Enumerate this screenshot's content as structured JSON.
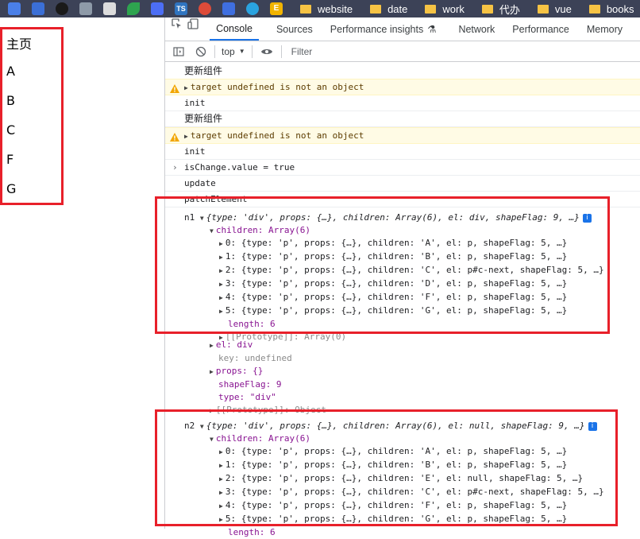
{
  "bookmarks": {
    "folders": [
      "website",
      "date",
      "work",
      "代办",
      "vue",
      "books"
    ],
    "icons": [
      {
        "name": "translate-icon",
        "color": "#4a7fe8",
        "label": ""
      },
      {
        "name": "shield-icon",
        "color": "#3b6fd6",
        "label": ""
      },
      {
        "name": "github-icon",
        "color": "#1a1a1a",
        "label": ""
      },
      {
        "name": "doc-icon",
        "color": "#8e9aa8",
        "label": ""
      },
      {
        "name": "page-icon",
        "color": "#dcdcdc",
        "label": ""
      },
      {
        "name": "leaf-icon",
        "color": "#2ea44f",
        "label": ""
      },
      {
        "name": "box-icon",
        "color": "#4c6ef5",
        "label": ""
      },
      {
        "name": "ts-icon",
        "color": "#2f74c0",
        "label": "TS"
      },
      {
        "name": "chrome-icon",
        "color": "#dd4b39",
        "label": ""
      },
      {
        "name": "check-icon",
        "color": "#3f6fe0",
        "label": ""
      },
      {
        "name": "telegram-icon",
        "color": "#2aa3e0",
        "label": ""
      },
      {
        "name": "e-icon",
        "color": "#f2b400",
        "label": "E"
      }
    ]
  },
  "page": {
    "items": [
      "主页",
      "A",
      "B",
      "C",
      "F",
      "G"
    ]
  },
  "devtools": {
    "tabs": [
      "Console",
      "Sources",
      "Performance insights",
      "Network",
      "Performance",
      "Memory"
    ],
    "context": "top",
    "filter_placeholder": "Filter",
    "logs": {
      "update1": "更新组件",
      "warn1": "target undefined is not an object",
      "init1": "init",
      "update2": "更新组件",
      "warn2": "target undefined is not an object",
      "init2": "init",
      "cmd": "isChange.value = true",
      "update": "update",
      "patch": "patchElement"
    },
    "n1": {
      "label": "n1",
      "summary": "{type: 'div', props: {…}, children: Array(6), el: div, shapeFlag: 9, …}",
      "children_label": "children: Array(6)",
      "rows": [
        "0: {type: 'p', props: {…}, children: 'A', el: p, shapeFlag: 5, …}",
        "1: {type: 'p', props: {…}, children: 'B', el: p, shapeFlag: 5, …}",
        "2: {type: 'p', props: {…}, children: 'C', el: p#c-next, shapeFlag: 5, …}",
        "3: {type: 'p', props: {…}, children: 'D', el: p, shapeFlag: 5, …}",
        "4: {type: 'p', props: {…}, children: 'F', el: p, shapeFlag: 5, …}",
        "5: {type: 'p', props: {…}, children: 'G', el: p, shapeFlag: 5, …}"
      ],
      "length": "length: 6",
      "proto_arr": "[[Prototype]]: Array(0)",
      "el": "el: div",
      "key": "key: undefined",
      "props": "props: {}",
      "shapeFlag": "shapeFlag: 9",
      "type": "type: \"div\"",
      "proto_obj": "[[Prototype]]: Object"
    },
    "n2": {
      "label": "n2",
      "summary": "{type: 'div', props: {…}, children: Array(6), el: null, shapeFlag: 9, …}",
      "children_label": "children: Array(6)",
      "rows": [
        "0: {type: 'p', props: {…}, children: 'A', el: p, shapeFlag: 5, …}",
        "1: {type: 'p', props: {…}, children: 'B', el: p, shapeFlag: 5, …}",
        "2: {type: 'p', props: {…}, children: 'E', el: null, shapeFlag: 5, …}",
        "3: {type: 'p', props: {…}, children: 'C', el: p#c-next, shapeFlag: 5, …}",
        "4: {type: 'p', props: {…}, children: 'F', el: p, shapeFlag: 5, …}",
        "5: {type: 'p', props: {…}, children: 'G', el: p, shapeFlag: 5, …}"
      ],
      "length": "length: 6"
    }
  }
}
